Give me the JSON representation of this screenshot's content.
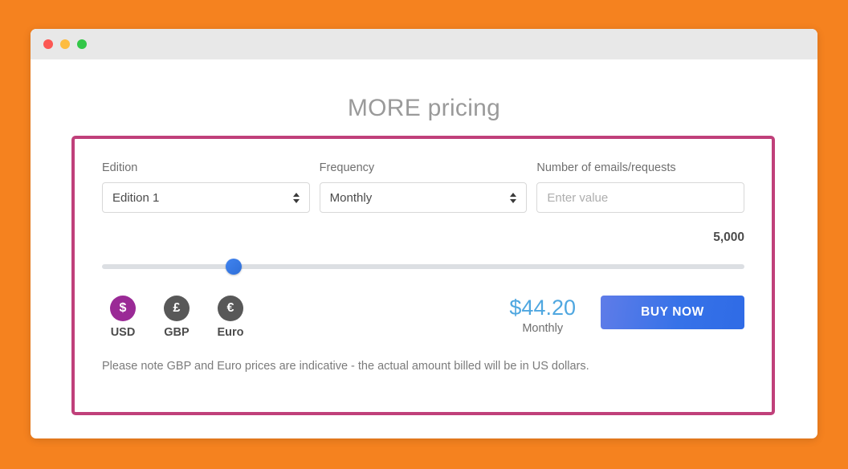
{
  "window": {
    "traffic_lights": [
      {
        "name": "close",
        "color": "#fc5753"
      },
      {
        "name": "minimize",
        "color": "#fdbc40"
      },
      {
        "name": "maximize",
        "color": "#33c748"
      }
    ]
  },
  "page": {
    "title": "MORE pricing",
    "background_color": "#f5821f",
    "panel_border_color": "#c0407a"
  },
  "form": {
    "edition": {
      "label": "Edition",
      "value": "Edition 1"
    },
    "frequency": {
      "label": "Frequency",
      "value": "Monthly"
    },
    "quantity": {
      "label": "Number of emails/requests",
      "placeholder": "Enter value",
      "value": ""
    }
  },
  "slider": {
    "value_label": "5,000",
    "percent": 20.5,
    "track_color": "#dcdfe3",
    "thumb_color": "#3672e8"
  },
  "currencies": [
    {
      "code": "USD",
      "symbol": "$",
      "active": true,
      "color": "#9a2a96"
    },
    {
      "code": "GBP",
      "symbol": "£",
      "active": false,
      "color": "#585858"
    },
    {
      "code": "Euro",
      "symbol": "€",
      "active": false,
      "color": "#585858"
    }
  ],
  "price": {
    "amount": "$44.20",
    "period": "Monthly",
    "color": "#4fa7e0"
  },
  "buy_button": {
    "label": "BUY NOW",
    "color": "#3672e8"
  },
  "footnote": "Please note GBP and Euro prices are indicative - the actual amount billed will be in US dollars."
}
